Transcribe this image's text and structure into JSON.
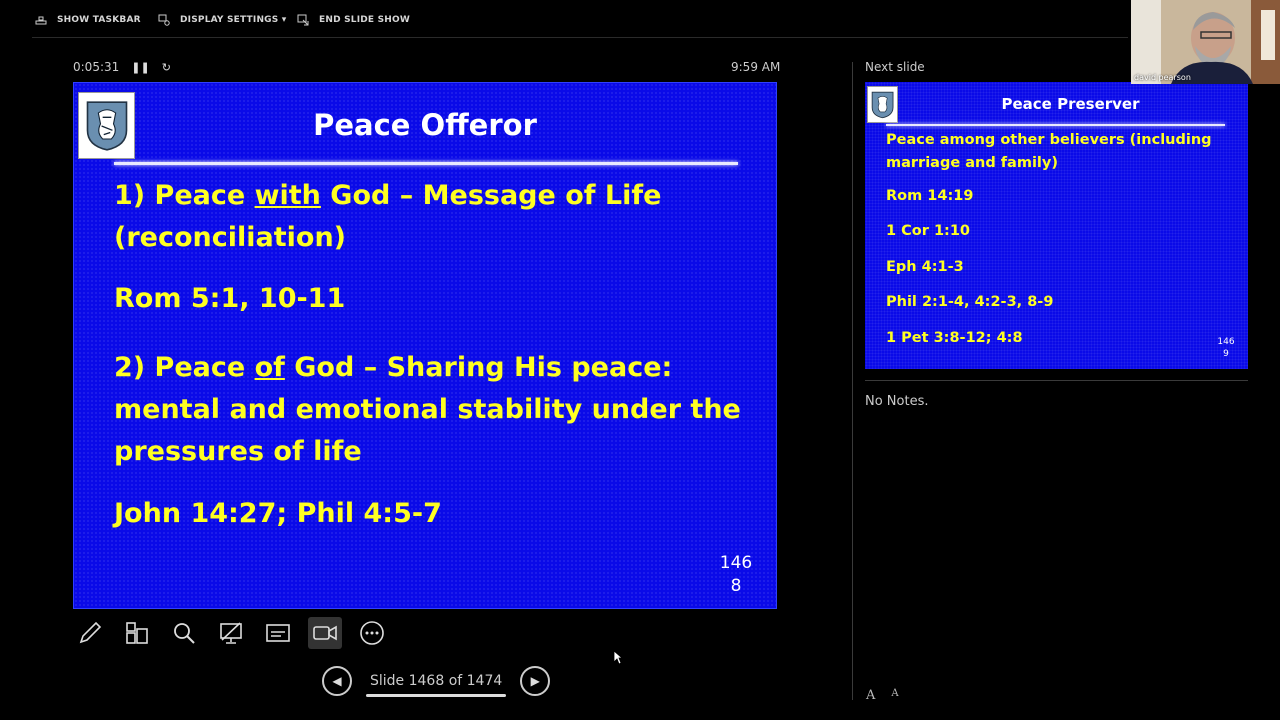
{
  "topbar": {
    "show_taskbar": "SHOW TASKBAR",
    "display_settings": "DISPLAY SETTINGS ▾",
    "end_slide_show": "END SLIDE SHOW"
  },
  "timer": {
    "elapsed": "0:05:31"
  },
  "clock": "9:59 AM",
  "current_slide": {
    "title": "Peace Offeror",
    "line1a": "1) Peace ",
    "line1b": "with",
    "line1c": " God – Message of Life",
    "line1d": "(reconciliation)",
    "ref1": "Rom 5:1, 10-11",
    "line2a": "2) Peace ",
    "line2b": "of",
    "line2c": " God – Sharing His peace:",
    "line2d": "mental and emotional stability under the",
    "line2e": "pressures of life",
    "ref2": "John 14:27; Phil 4:5-7",
    "num_top": "146",
    "num_bottom": "8"
  },
  "navigation": {
    "counter": "Slide 1468 of 1474"
  },
  "next_slide": {
    "label": "Next slide",
    "title": "Peace Preserver",
    "line1": "Peace among other believers (including",
    "line2": "marriage and family)",
    "ref1": "Rom 14:19",
    "ref2": "1 Cor 1:10",
    "ref3": "Eph 4:1-3",
    "ref4": "Phil 2:1-4, 4:2-3, 8-9",
    "ref5": "1 Pet 3:8-12; 4:8",
    "num_top": "146",
    "num_bottom": "9"
  },
  "notes": "No Notes.",
  "font_controls": {
    "increase": "A",
    "decrease": "A"
  },
  "video": {
    "participant_name": "david pearson"
  },
  "colors": {
    "slide_bg": "#0a0ae8",
    "slide_text": "#ffff22"
  }
}
